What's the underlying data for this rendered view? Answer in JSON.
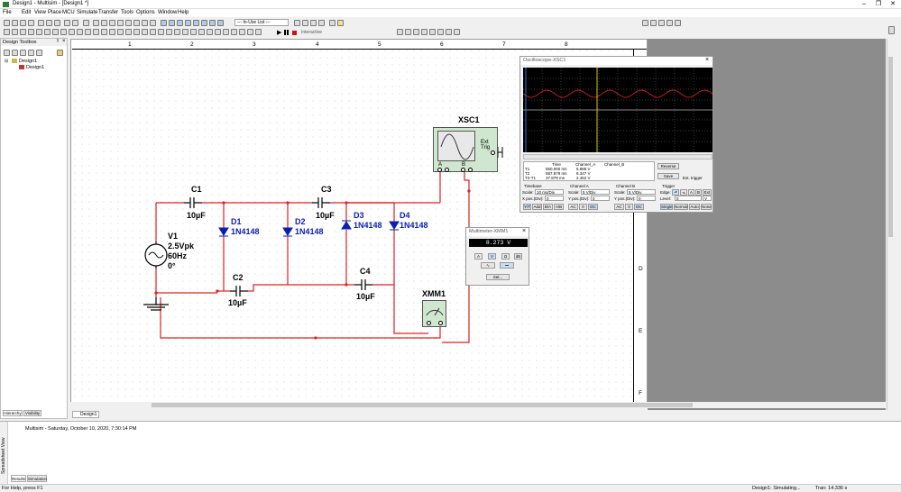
{
  "window": {
    "title": "Design1 - Multisim - [Design1 *]"
  },
  "menu": [
    "File",
    "Edit",
    "View",
    "Place",
    "MCU",
    "Simulate",
    "Transfer",
    "Tools",
    "Options",
    "Window",
    "Help"
  ],
  "toolbar": {
    "in_use_list": "--- In-Use List ---",
    "interactive": "Interactive"
  },
  "toolbox": {
    "title": "Design Toolbox",
    "tree": [
      "Design1",
      "Design1"
    ],
    "tabs": [
      "Hierarchy",
      "Visibility"
    ]
  },
  "ruler": {
    "cols": [
      "1",
      "2",
      "3",
      "4",
      "5",
      "6",
      "7",
      "8"
    ],
    "rows": [
      "D",
      "E",
      "F"
    ]
  },
  "design_tab": "Design1",
  "components": {
    "c1": {
      "ref": "C1",
      "value": "10µF"
    },
    "c2": {
      "ref": "C2",
      "value": "10µF"
    },
    "c3": {
      "ref": "C3",
      "value": "10µF"
    },
    "c4": {
      "ref": "C4",
      "value": "10µF"
    },
    "d1": {
      "ref": "D1",
      "model": "1N4148"
    },
    "d2": {
      "ref": "D2",
      "model": "1N4148"
    },
    "d3": {
      "ref": "D3",
      "model": "1N4148"
    },
    "d4": {
      "ref": "D4",
      "model": "1N4148"
    },
    "v1": {
      "ref": "V1",
      "amp": "2.5Vpk",
      "freq": "60Hz",
      "phase": "0°"
    },
    "xsc1": {
      "ref": "XSC1",
      "ext": "Ext Trig",
      "a": "A",
      "b": "B"
    },
    "xmm1": {
      "ref": "XMM1"
    }
  },
  "oscilloscope": {
    "title": "Oscilloscope-XSC1",
    "cursor_table": {
      "headers": [
        "",
        "Time",
        "Channel_A",
        "Channel_B"
      ],
      "rows": [
        [
          "T1",
          "550.000 ms",
          "5.885 V",
          ""
        ],
        [
          "T2",
          "587.879 ms",
          "8.347 V",
          ""
        ],
        [
          "T2-T1",
          "37.879 ms",
          "2.462 V",
          ""
        ]
      ]
    },
    "buttons": {
      "reverse": "Reverse",
      "save": "Save",
      "ext_trigger": "Ext. trigger"
    },
    "timebase": {
      "label": "Timebase",
      "scale_label": "Scale:",
      "scale": "10 ms/Div",
      "xpos_label": "X pos.(Div):",
      "xpos": "0",
      "modes": [
        "Y/T",
        "Add",
        "B/A",
        "A/B"
      ]
    },
    "channel_a": {
      "label": "Channel A",
      "scale_label": "Scale:",
      "scale": "5 V/Div",
      "ypos_label": "Y pos.(Div):",
      "ypos": "0",
      "modes": [
        "AC",
        "0",
        "DC"
      ]
    },
    "channel_b": {
      "label": "Channel B",
      "scale_label": "Scale:",
      "scale": "5 V/Div",
      "ypos_label": "Y pos.(Div):",
      "ypos": "0",
      "modes": [
        "AC",
        "0",
        "DC"
      ]
    },
    "trigger": {
      "label": "Trigger",
      "edge_label": "Edge:",
      "level_label": "Level:",
      "level": "0",
      "unit": "V",
      "modes": [
        "Single",
        "Normal",
        "Auto",
        "None"
      ],
      "sources": [
        "A",
        "B",
        "Ext"
      ]
    },
    "wave_color": "#c41a1a"
  },
  "multimeter": {
    "title": "Multimeter-XMM1",
    "reading": "8.273 V",
    "modes": [
      "A",
      "V",
      "Ω",
      "dB"
    ],
    "set_label": "Set..."
  },
  "output": {
    "lines": [
      "Multisim  -  Saturday, October 10, 2020, 7:30:14 PM"
    ],
    "tabs": [
      "Results",
      "Simulation"
    ],
    "side_label": "Spreadsheet View"
  },
  "status": {
    "help": "For Help, press F1",
    "sim": "Design1: Simulating...",
    "tran": "Tran: 14.336 s"
  },
  "colors": {
    "wire": "#e02020",
    "component_label": "#0b1fb2",
    "scope_bg": "#000000"
  }
}
